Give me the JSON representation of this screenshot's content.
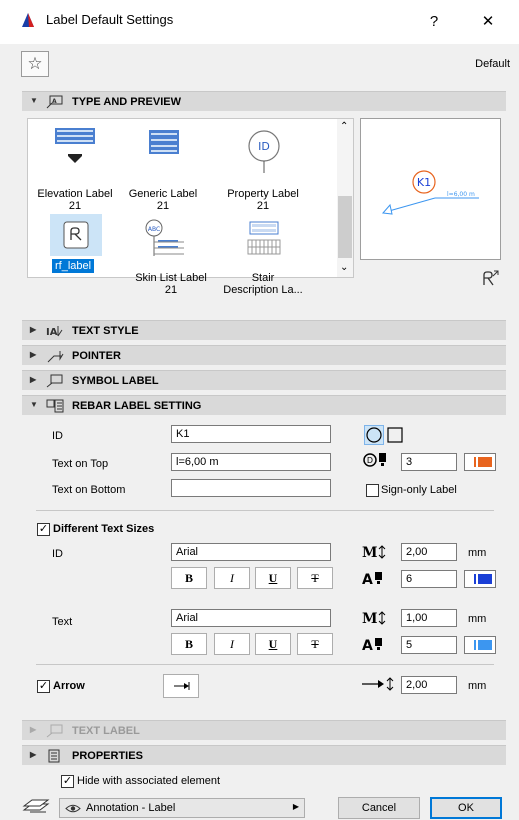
{
  "window": {
    "title": "Label Default Settings",
    "help_glyph": "?",
    "close_glyph": "✕"
  },
  "header": {
    "star_glyph": "☆",
    "default_label": "Default"
  },
  "sections": {
    "type_preview": "TYPE AND PREVIEW",
    "text_style": "TEXT STYLE",
    "pointer": "POINTER",
    "symbol_label": "SYMBOL LABEL",
    "rebar": "REBAR LABEL SETTING",
    "text_label": "TEXT LABEL",
    "properties": "PROPERTIES"
  },
  "label_types": [
    {
      "name": "Elevation Label",
      "count": "21",
      "icon": "elevation-label-icon"
    },
    {
      "name": "Generic Label",
      "count": "21",
      "icon": "generic-label-icon"
    },
    {
      "name": "Property Label",
      "count": "21",
      "icon": "property-label-icon"
    },
    {
      "name": "rf_label",
      "count": "",
      "icon": "rf-label-icon",
      "selected": true
    },
    {
      "name": "Skin List Label",
      "count": "21",
      "icon": "skin-list-label-icon"
    },
    {
      "name": "Stair",
      "count": "Description La...",
      "icon": "stair-description-label-icon"
    }
  ],
  "icon_texts": {
    "property_id": "ID",
    "skin_abc": "ABC"
  },
  "preview": {
    "marker": "K1",
    "text": "l=6,00 m"
  },
  "rebar": {
    "id_label": "ID",
    "id_value": "K1",
    "top_label": "Text on Top",
    "top_value": "l=6,00 m",
    "bottom_label": "Text on Bottom",
    "bottom_value": "",
    "pen_value": "3",
    "sign_only_label": "Sign-only Label",
    "diff_sizes_label": "Different Text Sizes",
    "id_font_label": "ID",
    "id_font": "Arial",
    "id_size": "2,00",
    "id_pen": "6",
    "text_font_label": "Text",
    "text_font": "Arial",
    "text_size": "1,00",
    "text_pen": "5",
    "unit": "mm",
    "arrow_label": "Arrow",
    "arrow_size": "2,00",
    "bold": "B",
    "italic": "I",
    "underline": "U",
    "strike": "T",
    "colors": {
      "pen3": "#e8641e",
      "pen6": "#1a3fd6",
      "pen5": "#3c96f0"
    }
  },
  "footer": {
    "hide_label": "Hide with associated element",
    "layer": "Annotation - Label",
    "cancel": "Cancel",
    "ok": "OK"
  }
}
